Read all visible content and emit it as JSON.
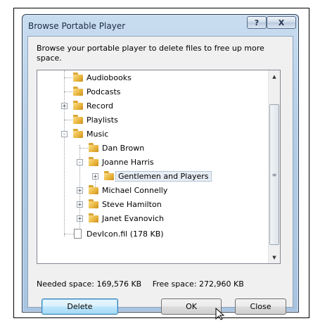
{
  "window": {
    "title": "Browse Portable Player",
    "help_button": "?",
    "close_button": "X"
  },
  "description": "Browse your portable player to delete files to free up more space.",
  "tree": {
    "items": [
      {
        "label": "Audiobooks",
        "type": "folder"
      },
      {
        "label": "Podcasts",
        "type": "folder"
      },
      {
        "label": "Record",
        "type": "folder",
        "expander": "+"
      },
      {
        "label": "Playlists",
        "type": "folder"
      },
      {
        "label": "Music",
        "type": "folder",
        "expander": "-"
      },
      {
        "label": "Dan Brown",
        "type": "folder"
      },
      {
        "label": "Joanne Harris",
        "type": "folder",
        "expander": "-"
      },
      {
        "label": "Gentlemen and Players",
        "type": "folder",
        "expander": "+"
      },
      {
        "label": "Michael Connelly",
        "type": "folder",
        "expander": "+"
      },
      {
        "label": "Steve Hamilton",
        "type": "folder",
        "expander": "+"
      },
      {
        "label": "Janet Evanovich",
        "type": "folder",
        "expander": "+"
      },
      {
        "label": "DevIcon.fil (178 KB)",
        "type": "file"
      }
    ]
  },
  "space": {
    "needed": "Needed space: 169,576 KB",
    "free": "Free space: 272,960 KB"
  },
  "buttons": {
    "delete": "Delete",
    "ok": "OK",
    "close": "Close"
  }
}
